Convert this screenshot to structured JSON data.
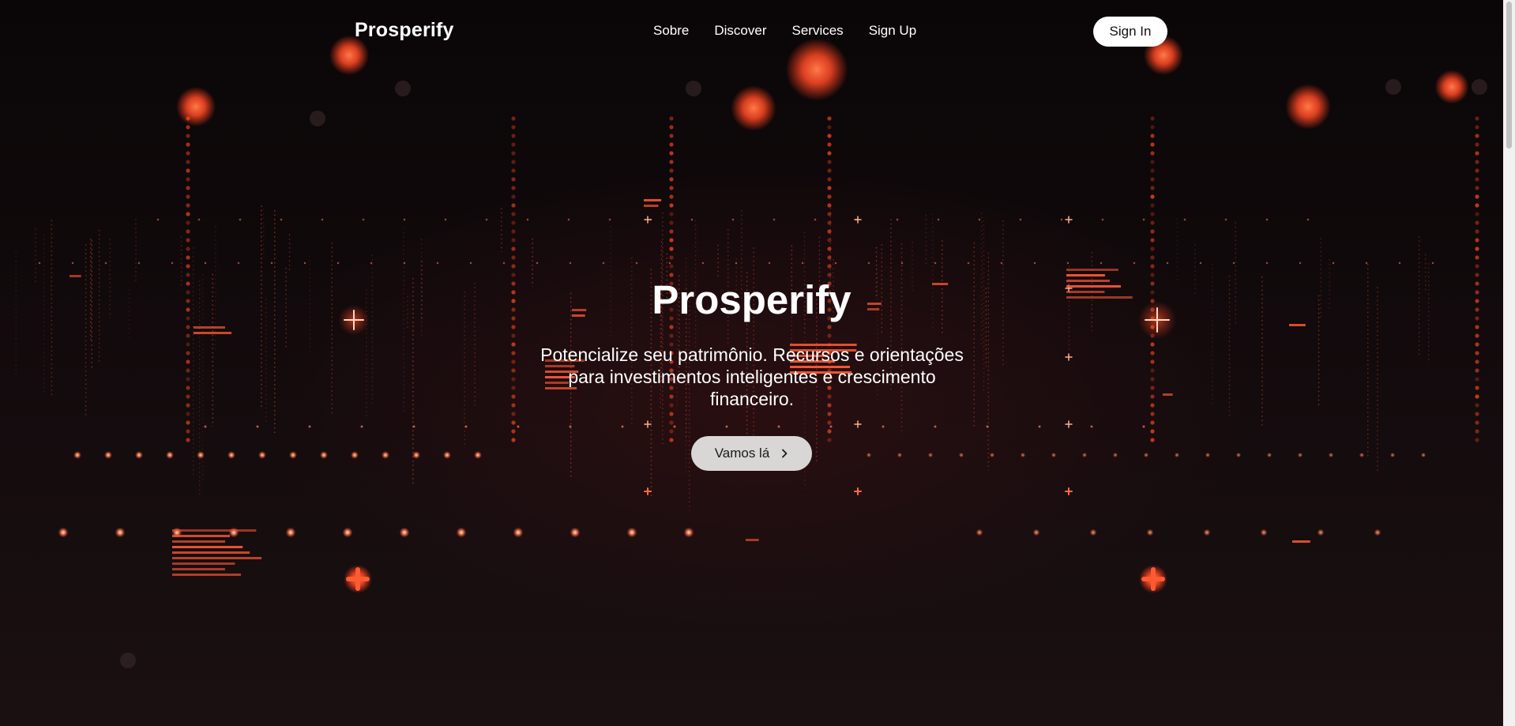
{
  "header": {
    "brand": "Prosperify",
    "nav": [
      "Sobre",
      "Discover",
      "Services",
      "Sign Up"
    ],
    "signin_label": "Sign In"
  },
  "hero": {
    "title": "Prosperify",
    "subtitle": "Potencialize seu patrimônio. Recursos e orientações para investimentos inteligentes e crescimento financeiro.",
    "cta_label": "Vamos lá",
    "cta_icon": "chevron-right-icon"
  },
  "colors": {
    "background": "#0d0709",
    "accent": "#ff5a36",
    "button_light": "#ffffff",
    "cta_bg": "#d9d6d6"
  }
}
